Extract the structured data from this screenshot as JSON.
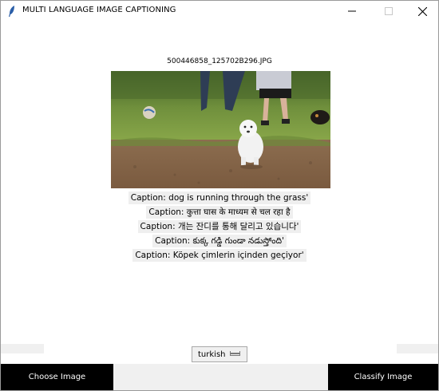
{
  "window": {
    "title": "MULTI LANGUAGE IMAGE CAPTIONING",
    "icon": "feather-icon"
  },
  "image": {
    "filename": "500446858_125702B296.JPG"
  },
  "captions": [
    "Caption: dog is running through the grass'",
    "Caption: कुत्ता घास के माध्यम से चल रहा है",
    "Caption: 개는 잔디를 통해 달리고 있습니다'",
    "Caption: కుక్క గడ్డి గుండా నడుస్తోంది'",
    "Caption: Köpek çimlerin içinden geçiyor'"
  ],
  "language_select": {
    "value": "turkish"
  },
  "buttons": {
    "choose_image": "Choose Image",
    "classify_image": "Classify Image"
  }
}
